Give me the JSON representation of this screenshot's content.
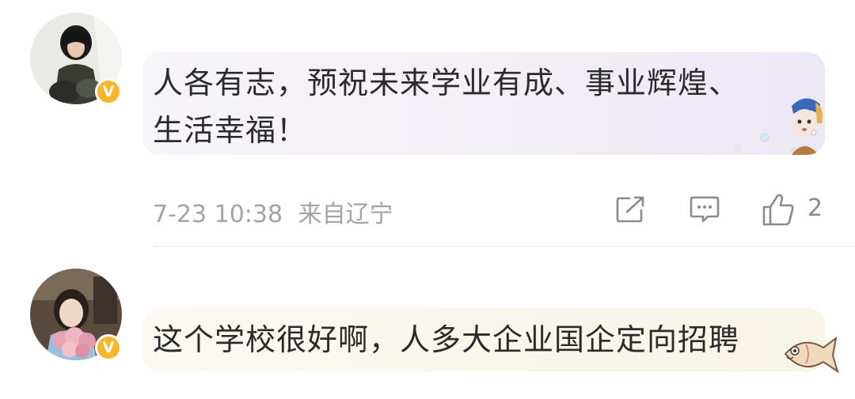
{
  "comments": [
    {
      "text_line1": "人各有志，预祝未来学业有成、事业辉煌、",
      "text_line2": "生活幸福！",
      "badge": "V",
      "timestamp": "7-23 10:38",
      "location": "来自辽宁",
      "like_count": "2",
      "bubble_color": "#f2eef6"
    },
    {
      "text_line1": "这个学校很好啊，人多大企业国企定向招聘",
      "badge": "V",
      "bubble_color": "#f7f4e7"
    }
  ],
  "colors": {
    "verified_badge": "#f7b52c",
    "meta_text": "#a3a3a3"
  },
  "icons": [
    "share-icon",
    "comment-icon",
    "like-icon",
    "girl-pearl-earring-sticker",
    "fish-sticker"
  ]
}
